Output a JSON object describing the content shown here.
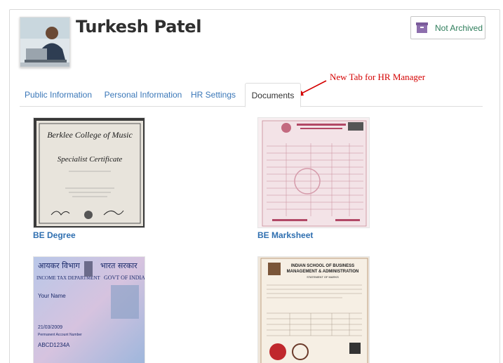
{
  "profile": {
    "name": "Turkesh Patel",
    "archive_status": "Not Archived"
  },
  "annotation": "New Tab for HR Manager",
  "tabs": [
    {
      "label": "Public Information"
    },
    {
      "label": "Personal Information"
    },
    {
      "label": "HR Settings"
    },
    {
      "label": "Documents"
    }
  ],
  "active_tab": "Documents",
  "documents": [
    {
      "label": "BE Degree",
      "image_text": [
        "Berklee College of Music",
        "Specialist Certificate"
      ]
    },
    {
      "label": "BE Marksheet",
      "image_text": []
    },
    {
      "label": "",
      "image_text": [
        "आयकर विभाग",
        "भारत सरकार",
        "INCOME TAX DEPARTMENT",
        "GOVT OF INDIA",
        "Your Name",
        "21/03/2009",
        "Permanent Account Number",
        "ABCD1234A"
      ]
    },
    {
      "label": "",
      "image_text": [
        "INDIAN SCHOOL OF BUSINESS",
        "MANAGEMENT & ADMINISTRATION",
        "STATEMENT OF MARKS"
      ]
    }
  ],
  "colors": {
    "link": "#2f6fb0",
    "annotation": "#d40000",
    "archive_text": "#2e7d5b",
    "archive_icon": "#7a5a9a"
  }
}
